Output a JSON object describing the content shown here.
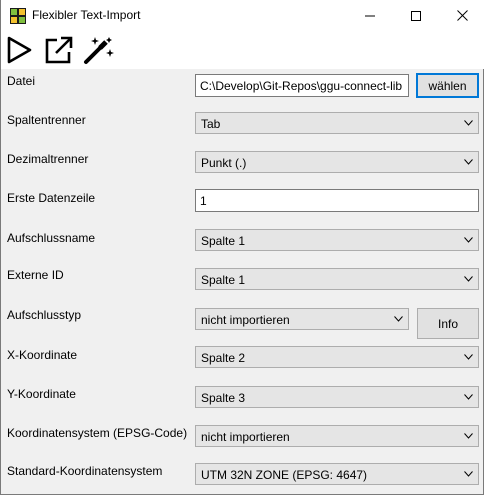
{
  "window": {
    "title": "Flexibler Text-Import",
    "controls": {
      "minimize": "minimize-icon",
      "maximize": "maximize-icon",
      "close": "close-icon"
    }
  },
  "toolbar": {
    "items": [
      {
        "name": "run",
        "icon": "play-icon"
      },
      {
        "name": "open-external",
        "icon": "external-link-icon"
      },
      {
        "name": "auto-detect",
        "icon": "magic-wand-icon"
      }
    ]
  },
  "form": {
    "file": {
      "label": "Datei",
      "value": "C:\\Develop\\Git-Repos\\ggu-connect-lib",
      "button": "wählen"
    },
    "column_separator": {
      "label": "Spaltentrenner",
      "value": "Tab"
    },
    "decimal_separator": {
      "label": "Dezimaltrenner",
      "value": "Punkt (.)"
    },
    "first_data_row": {
      "label": "Erste Datenzeile",
      "value": "1"
    },
    "borehole_name": {
      "label": "Aufschlussname",
      "value": "Spalte 1"
    },
    "external_id": {
      "label": "Externe ID",
      "value": "Spalte 1"
    },
    "borehole_type": {
      "label": "Aufschlusstyp",
      "value": "nicht importieren",
      "button": "Info"
    },
    "x_coordinate": {
      "label": "X-Koordinate",
      "value": "Spalte 2"
    },
    "y_coordinate": {
      "label": "Y-Koordinate",
      "value": "Spalte 3"
    },
    "coordinate_system": {
      "label": "Koordinatensystem (EPSG-Code)",
      "value": "nicht importieren"
    },
    "default_coordinate_system": {
      "label": "Standard-Koordinatensystem",
      "value": "UTM 32N ZONE (EPSG: 4647)"
    }
  },
  "colors": {
    "focus_border": "#0078d7",
    "combo_bg": "#e5e5e5",
    "window_bg": "#f0f0f0"
  }
}
